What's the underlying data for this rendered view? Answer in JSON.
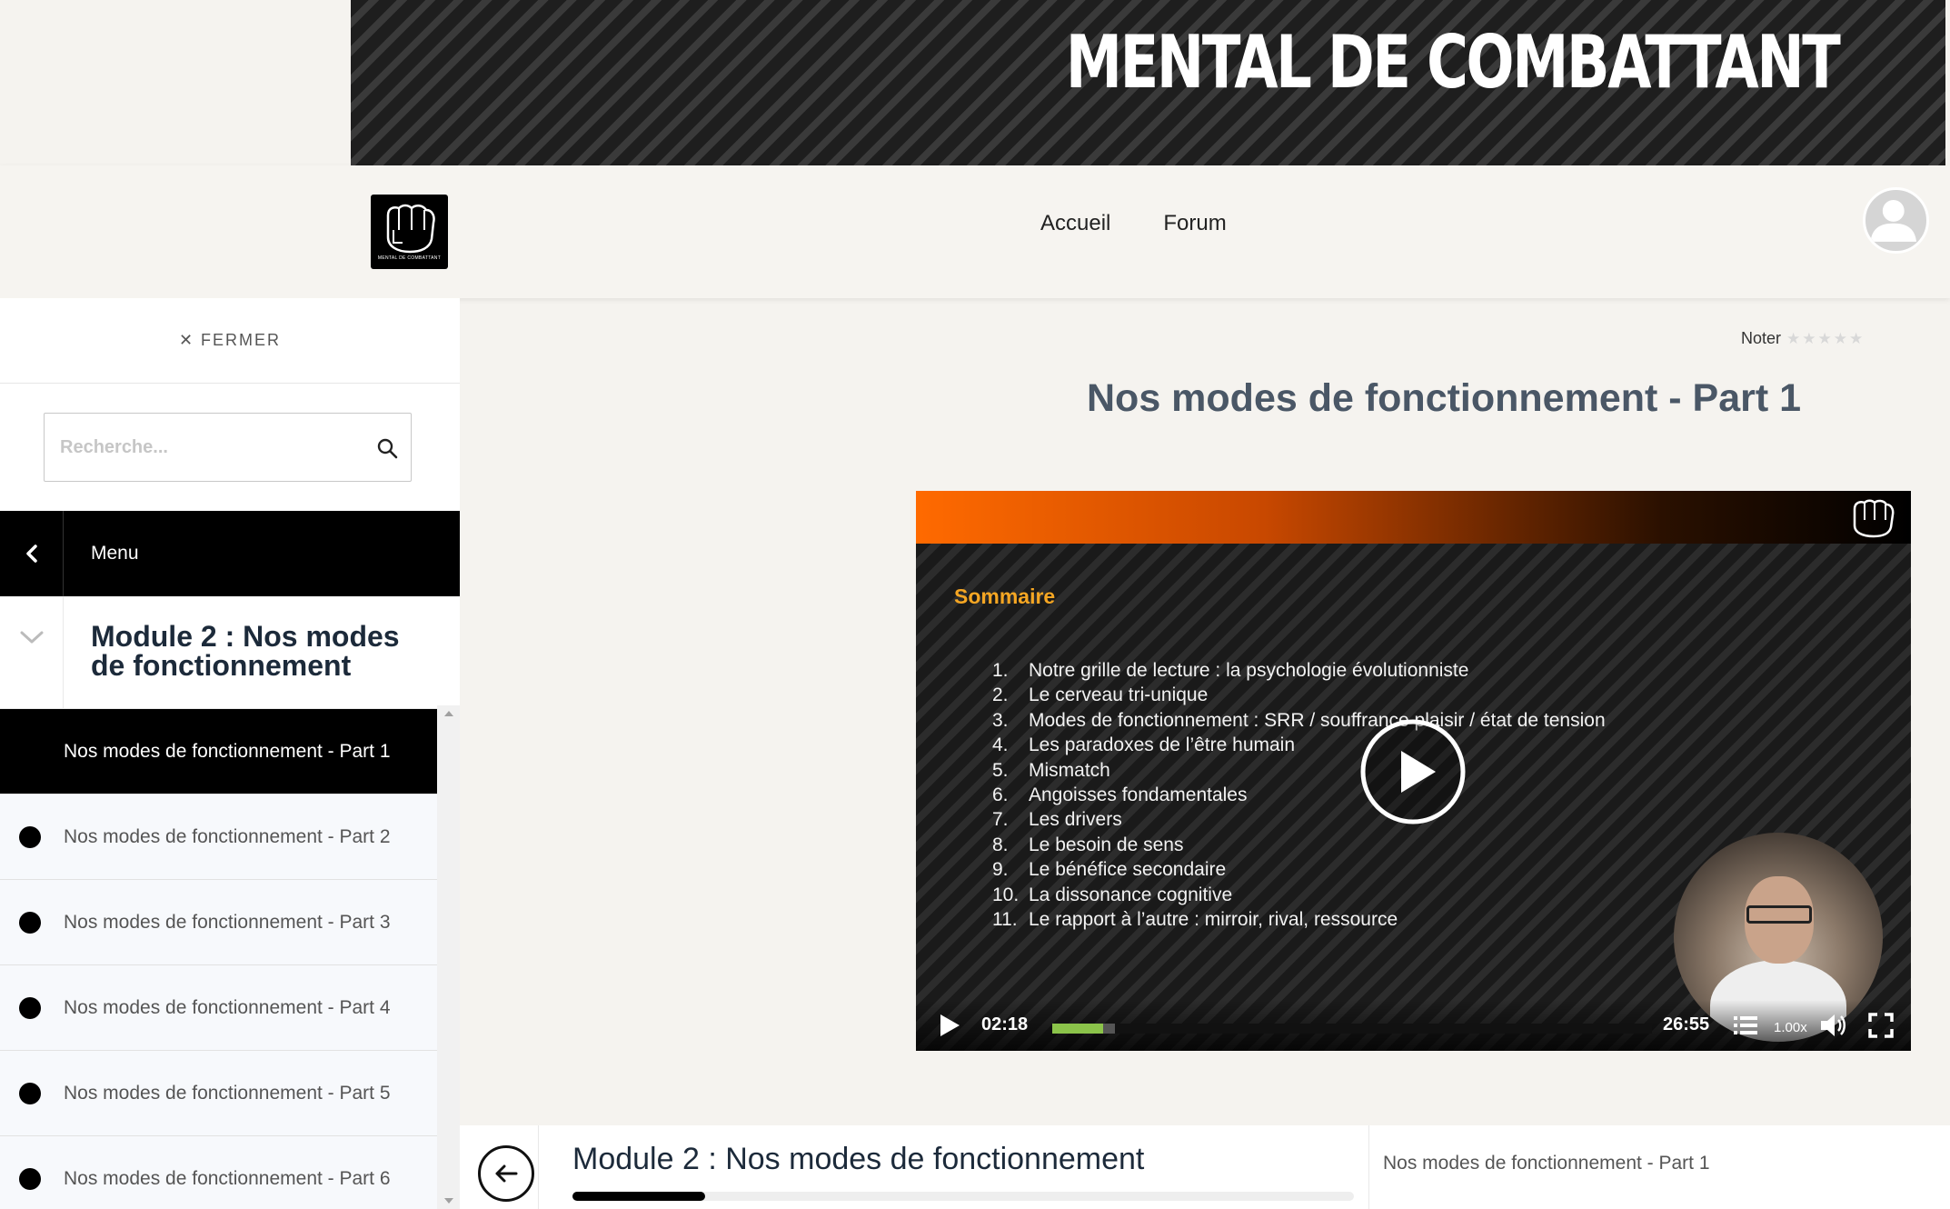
{
  "banner": {
    "title": "MENTAL DE COMBATTANT"
  },
  "header": {
    "logo_text": "MENTAL DE COMBATTANT",
    "nav": [
      {
        "label": "Accueil"
      },
      {
        "label": "Forum"
      }
    ]
  },
  "sidebar": {
    "close_label": "✕ FERMER",
    "search_placeholder": "Recherche...",
    "menu_label": "Menu",
    "module_title": "Module 2 : Nos modes de fonctionnement",
    "lessons": [
      {
        "label": "Nos modes de fonctionnement - Part 1",
        "active": true
      },
      {
        "label": "Nos modes de fonctionnement - Part 2",
        "active": false
      },
      {
        "label": "Nos modes de fonctionnement - Part 3",
        "active": false
      },
      {
        "label": "Nos modes de fonctionnement - Part 4",
        "active": false
      },
      {
        "label": "Nos modes de fonctionnement - Part 5",
        "active": false
      },
      {
        "label": "Nos modes de fonctionnement - Part 6",
        "active": false
      }
    ]
  },
  "main": {
    "rating_label": "Noter",
    "rating_stars": "★★★★★",
    "rating_value": 0,
    "title": "Nos modes de fonctionnement - Part 1",
    "video": {
      "slide_heading": "Sommaire",
      "toc": [
        {
          "num": "1.",
          "text": "Notre grille de lecture : la psychologie évolutionniste"
        },
        {
          "num": "2.",
          "text": "Le cerveau tri-unique"
        },
        {
          "num": "3.",
          "text": "Modes de fonctionnement : SRR / souffrance plaisir / état de tension"
        },
        {
          "num": "4.",
          "text": "Les paradoxes de l’être humain"
        },
        {
          "num": "5.",
          "text": "Mismatch"
        },
        {
          "num": "6.",
          "text": "Angoisses fondamentales"
        },
        {
          "num": "7.",
          "text": "Les drivers"
        },
        {
          "num": "8.",
          "text": "Le besoin de sens"
        },
        {
          "num": "9.",
          "text": "Le bénéfice secondaire"
        },
        {
          "num": "10.",
          "text": "La dissonance cognitive"
        },
        {
          "num": "11.",
          "text": "Le rapport à l’autre : mirroir, rival, ressource"
        }
      ],
      "current_time": "02:18",
      "duration": "26:55",
      "progress_fraction": 0.0855,
      "buffered_fraction": 0.105,
      "speed": "1.00x"
    }
  },
  "bottom": {
    "module_title": "Module 2 : Nos modes de fonctionnement",
    "module_progress_fraction": 0.17,
    "current_lesson": "Nos modes de fonctionnement - Part 1"
  },
  "colors": {
    "accent_orange": "#ff6a00",
    "slide_heading": "#f5a623",
    "progress_fill": "#8bc34a",
    "title_text": "#4a5766"
  }
}
